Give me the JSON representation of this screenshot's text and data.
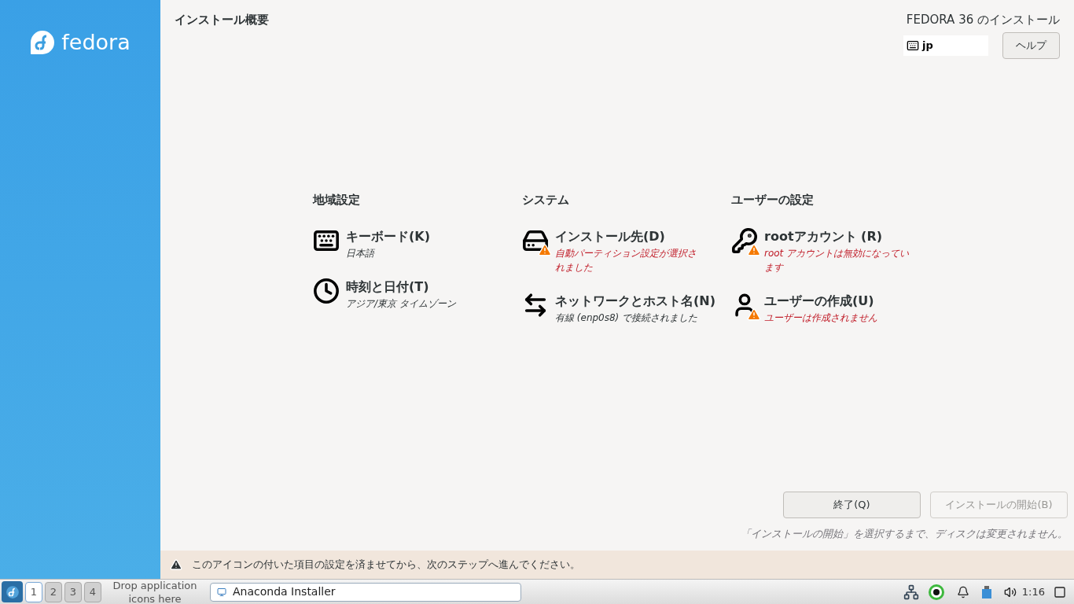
{
  "sidebar": {
    "logo_text": "fedora"
  },
  "header": {
    "title": "インストール概要",
    "product": "FEDORA 36 のインストール",
    "keyboard_layout": "jp",
    "help_button": "ヘルプ"
  },
  "categories": [
    {
      "title": "地域設定",
      "spokes": [
        {
          "kind": "keyboard",
          "title": "キーボード(K)",
          "status": "日本語",
          "warning": false
        },
        {
          "kind": "clock",
          "title": "時刻と日付(T)",
          "status": "アジア/東京 タイムゾーン",
          "warning": false
        }
      ]
    },
    {
      "title": "システム",
      "spokes": [
        {
          "kind": "disk",
          "title": "インストール先(D)",
          "status": "自動パーティション設定が選択されました",
          "warning": true
        },
        {
          "kind": "network",
          "title": "ネットワークとホスト名(N)",
          "status": "有線 (enp0s8) で接続されました",
          "warning": false
        }
      ]
    },
    {
      "title": "ユーザーの設定",
      "spokes": [
        {
          "kind": "key",
          "title": "rootアカウント (R)",
          "status": "root アカウントは無効になっています",
          "warning": true
        },
        {
          "kind": "user",
          "title": "ユーザーの作成(U)",
          "status": "ユーザーは作成されません",
          "warning": true
        }
      ]
    }
  ],
  "actions": [
    {
      "label": "終了(Q)",
      "disabled": false
    },
    {
      "label": "インストールの開始(B)",
      "disabled": true
    }
  ],
  "action_note": "「インストールの開始」を選択するまで、ディスクは変更されません。",
  "warning_bar": "このアイコンの付いた項目の設定を済ませてから、次のステップへ進んでください。",
  "taskbar": {
    "workspaces": [
      {
        "label": "1",
        "selected": true
      },
      {
        "label": "2",
        "selected": false
      },
      {
        "label": "3",
        "selected": false
      },
      {
        "label": "4",
        "selected": false
      }
    ],
    "launcher_hint": "Drop application icons here",
    "task": "Anaconda Installer",
    "clock": "1:16"
  }
}
